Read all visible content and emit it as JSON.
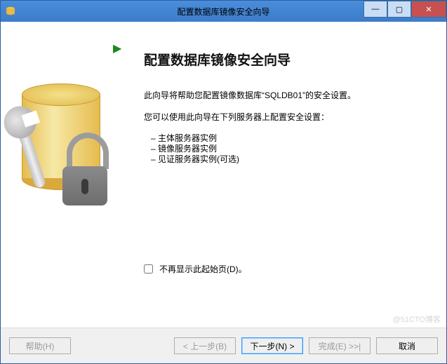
{
  "window": {
    "title": "配置数据库镜像安全向导"
  },
  "page": {
    "heading": "配置数据库镜像安全向导",
    "intro": "此向导将帮助您配置镜像数据库“SQLDB01”的安全设置。",
    "servers_intro": "您可以使用此向导在下列服务器上配置安全设置：",
    "bullets": [
      "主体服务器实例",
      "镜像服务器实例",
      "见证服务器实例(可选)"
    ],
    "checkbox_label": "不再显示此起始页(D)。",
    "checkbox_checked": false
  },
  "buttons": {
    "help": "帮助(H)",
    "back": "< 上一步(B)",
    "next": "下一步(N) >",
    "finish": "完成(E) >>|",
    "cancel": "取消"
  },
  "watermark": "@51CTO博客"
}
